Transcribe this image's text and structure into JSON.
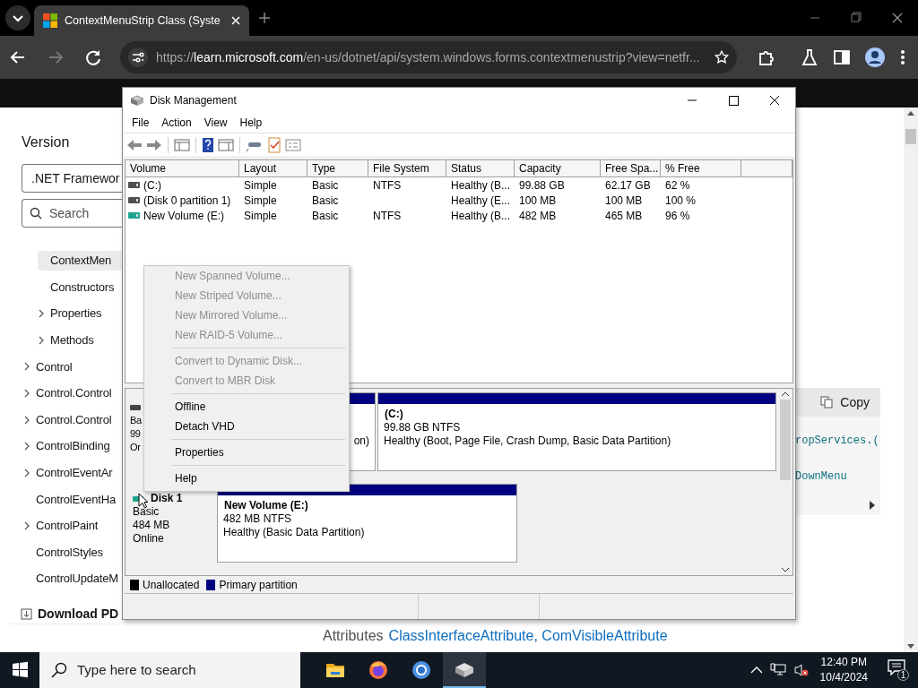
{
  "browser": {
    "tab": {
      "title": "ContextMenuStrip Class (Syste",
      "selected": true
    },
    "url": {
      "scheme": "https://",
      "host": "learn.microsoft.com",
      "path": "/en-us/dotnet/api/system.windows.forms.contextmenustrip?view=netfr..."
    }
  },
  "web_page": {
    "sidebar": {
      "heading": "Version",
      "version_select": ".NET Framewor",
      "search": {
        "placeholder": "Search"
      },
      "tree": [
        {
          "children": [
            {
              "label": "ContextMen",
              "selected": true,
              "expandable": false
            },
            {
              "label": "Constructors",
              "selected": false,
              "expandable": false
            },
            {
              "label": "Properties",
              "selected": false,
              "expandable": true
            },
            {
              "label": "Methods",
              "selected": false,
              "expandable": true
            }
          ]
        },
        {
          "label": "Control",
          "selected": false,
          "expandable": true
        },
        {
          "label": "Control.Control",
          "selected": false,
          "expandable": true
        },
        {
          "label": "Control.Control",
          "selected": false,
          "expandable": true
        },
        {
          "label": "ControlBinding",
          "selected": false,
          "expandable": true
        },
        {
          "label": "ControlEventAr",
          "selected": false,
          "expandable": true
        },
        {
          "label": "ControlEventHa",
          "selected": false,
          "expandable": false
        },
        {
          "label": "ControlPaint",
          "selected": false,
          "expandable": true
        },
        {
          "label": "ControlStyles",
          "selected": false,
          "expandable": false
        },
        {
          "label": "ControlUpdateM",
          "selected": false,
          "expandable": false
        }
      ],
      "download": "Download PD"
    },
    "code_panel": {
      "copy": "Copy",
      "lines": [
        "ropServices.(",
        "DownMenu"
      ]
    },
    "attributes": {
      "label": "Attributes",
      "value": "ClassInterfaceAttribute, ComVisibleAttribute"
    }
  },
  "disk_management": {
    "title": "Disk Management",
    "menu": [
      "File",
      "Action",
      "View",
      "Help"
    ],
    "columns": [
      "Volume",
      "Layout",
      "Type",
      "File System",
      "Status",
      "Capacity",
      "Free Spa...",
      "% Free"
    ],
    "rows": [
      {
        "color": "#505050",
        "volume": "(C:)",
        "layout": "Simple",
        "type": "Basic",
        "file_system": "NTFS",
        "status": "Healthy (B...",
        "capacity": "99.88 GB",
        "free_space": "62.17 GB",
        "percent_free": "62 %"
      },
      {
        "color": "#505050",
        "volume": "(Disk 0 partition 1)",
        "layout": "Simple",
        "type": "Basic",
        "status": "Healthy (E...",
        "capacity": "100 MB",
        "free_space": "100 MB",
        "percent_free": "100 %"
      },
      {
        "color": "#1fa58f",
        "volume": "New Volume (E:)",
        "layout": "Simple",
        "type": "Basic",
        "file_system": "NTFS",
        "status": "Healthy (B...",
        "capacity": "482 MB",
        "free_space": "465 MB",
        "percent_free": "96 %"
      }
    ],
    "disks": [
      {
        "info": [
          "Ba",
          "99",
          "Or"
        ],
        "partitions": [
          {
            "lines": [
              "on)"
            ]
          },
          {
            "title": "(C:)",
            "lines": [
              "99.88 GB NTFS",
              "Healthy (Boot, Page File, Crash Dump, Basic Data Partition)"
            ]
          }
        ]
      },
      {
        "name": "Disk 1",
        "info": [
          "Basic",
          "484 MB",
          "Online"
        ],
        "partitions": [
          {
            "title": "New Volume  (E:)",
            "lines": [
              "482 MB NTFS",
              "Healthy (Basic Data Partition)"
            ]
          }
        ]
      }
    ],
    "legend": [
      {
        "label": "Unallocated",
        "color": "#000000"
      },
      {
        "label": "Primary partition",
        "color": "#000080"
      }
    ]
  },
  "context_menu": [
    {
      "kind": "item",
      "label": "New Spanned Volume...",
      "disabled": true
    },
    {
      "kind": "item",
      "label": "New Striped Volume...",
      "disabled": true
    },
    {
      "kind": "item",
      "label": "New Mirrored Volume...",
      "disabled": true
    },
    {
      "kind": "item",
      "label": "New RAID-5 Volume...",
      "disabled": true
    },
    {
      "kind": "separator"
    },
    {
      "kind": "item",
      "label": "Convert to Dynamic Disk...",
      "disabled": true
    },
    {
      "kind": "item",
      "label": "Convert to MBR Disk",
      "disabled": true
    },
    {
      "kind": "separator"
    },
    {
      "kind": "item",
      "label": "Offline",
      "disabled": false
    },
    {
      "kind": "item",
      "label": "Detach VHD",
      "disabled": false
    },
    {
      "kind": "separator"
    },
    {
      "kind": "item",
      "label": "Properties",
      "disabled": false
    },
    {
      "kind": "separator"
    },
    {
      "kind": "item",
      "label": "Help",
      "disabled": false
    }
  ],
  "taskbar": {
    "search": {
      "placeholder": "Type here to search"
    },
    "apps": [
      {
        "selected": false
      },
      {
        "selected": false
      },
      {
        "selected": false
      },
      {
        "selected": true
      }
    ],
    "time": "12:40 PM",
    "date": "10/4/2024",
    "notifications": "1"
  }
}
